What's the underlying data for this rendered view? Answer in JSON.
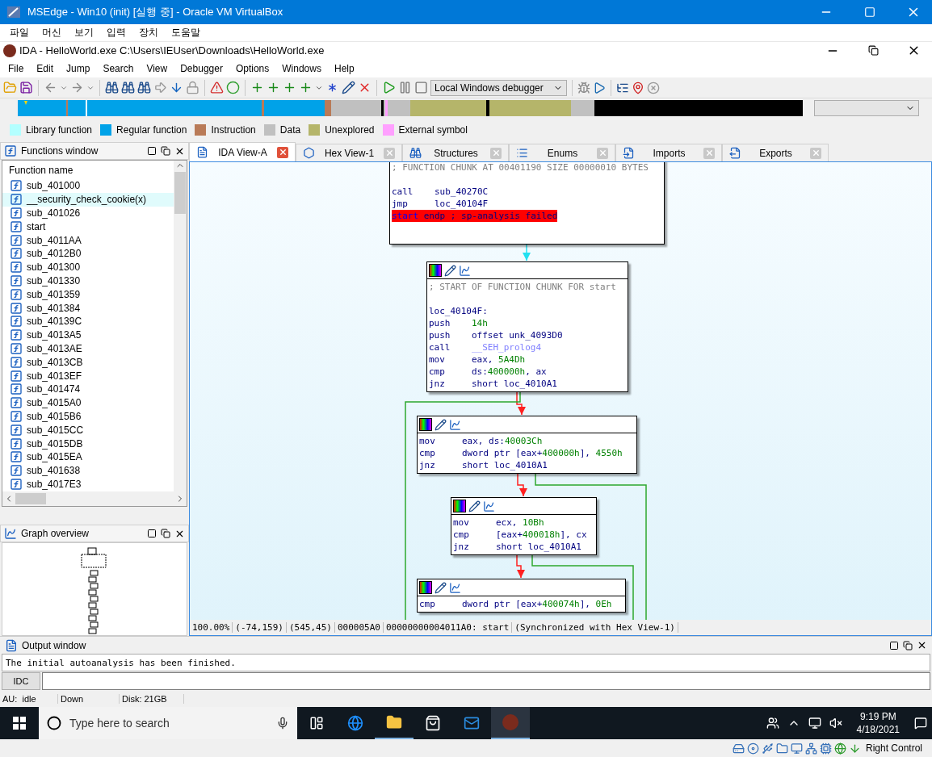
{
  "vbox_window": {
    "title": "MSEdge - Win10 (init) [실행 중] - Oracle VM VirtualBox",
    "menu": [
      "파일",
      "머신",
      "보기",
      "입력",
      "장치",
      "도움말"
    ]
  },
  "ida_window": {
    "title": "IDA - HelloWorld.exe C:\\Users\\IEUser\\Downloads\\HelloWorld.exe",
    "menu": [
      "File",
      "Edit",
      "Jump",
      "Search",
      "View",
      "Debugger",
      "Options",
      "Windows",
      "Help"
    ]
  },
  "toolbar": {
    "debugger_select": "Local Windows debugger"
  },
  "legend": [
    {
      "label": "Library function",
      "color": "#b3ffff"
    },
    {
      "label": "Regular function",
      "color": "#00a2e8"
    },
    {
      "label": "Instruction",
      "color": "#b97a57"
    },
    {
      "label": "Data",
      "color": "#c0c0c0"
    },
    {
      "label": "Unexplored",
      "color": "#b5b56a"
    },
    {
      "label": "External symbol",
      "color": "#ffa0ff"
    }
  ],
  "functions_window": {
    "title": "Functions window",
    "column": "Function name",
    "functions": [
      {
        "name": "sub_401000",
        "library": false
      },
      {
        "name": "__security_check_cookie(x)",
        "library": true
      },
      {
        "name": "sub_401026",
        "library": false
      },
      {
        "name": "start",
        "library": false
      },
      {
        "name": "sub_4011AA",
        "library": false
      },
      {
        "name": "sub_4012B0",
        "library": false
      },
      {
        "name": "sub_401300",
        "library": false
      },
      {
        "name": "sub_401330",
        "library": false
      },
      {
        "name": "sub_401359",
        "library": false
      },
      {
        "name": "sub_401384",
        "library": false
      },
      {
        "name": "sub_40139C",
        "library": false
      },
      {
        "name": "sub_4013A5",
        "library": false
      },
      {
        "name": "sub_4013AE",
        "library": false
      },
      {
        "name": "sub_4013CB",
        "library": false
      },
      {
        "name": "sub_4013EF",
        "library": false
      },
      {
        "name": "sub_401474",
        "library": false
      },
      {
        "name": "sub_4015A0",
        "library": false
      },
      {
        "name": "sub_4015B6",
        "library": false
      },
      {
        "name": "sub_4015CC",
        "library": false
      },
      {
        "name": "sub_4015DB",
        "library": false
      },
      {
        "name": "sub_4015EA",
        "library": false
      },
      {
        "name": "sub_401638",
        "library": false
      },
      {
        "name": "sub_4017E3",
        "library": false
      }
    ]
  },
  "graph_overview": {
    "title": "Graph overview"
  },
  "tabs": [
    {
      "label": "IDA View-A",
      "selected": true
    },
    {
      "label": "Hex View-1",
      "selected": false
    },
    {
      "label": "Structures",
      "selected": false
    },
    {
      "label": "Enums",
      "selected": false
    },
    {
      "label": "Imports",
      "selected": false
    },
    {
      "label": "Exports",
      "selected": false
    }
  ],
  "graph": {
    "nodes": [
      {
        "header": false,
        "lines": [
          {
            "kind": "comment",
            "text": "; FUNCTION CHUNK AT 00401190 SIZE 00000010 BYTES"
          },
          {
            "kind": "blank"
          },
          {
            "kind": "insn",
            "mnemonic": "call",
            "operands": [
              {
                "text": "sub_40270C",
                "kind": "name"
              }
            ]
          },
          {
            "kind": "insn",
            "mnemonic": "jmp",
            "operands": [
              {
                "text": "loc_40104F",
                "kind": "name"
              }
            ]
          },
          {
            "kind": "error",
            "keyword": "start",
            "text": "endp ; sp-analysis failed"
          },
          {
            "kind": "blank"
          }
        ]
      },
      {
        "header": true,
        "lines": [
          {
            "kind": "comment",
            "text": "; START OF FUNCTION CHUNK FOR start"
          },
          {
            "kind": "blank"
          },
          {
            "kind": "label",
            "text": "loc_40104F:"
          },
          {
            "kind": "insn",
            "mnemonic": "push",
            "operands": [
              {
                "text": "14h",
                "kind": "num"
              }
            ]
          },
          {
            "kind": "insn",
            "mnemonic": "push",
            "operands": [
              {
                "text": "offset unk_4093D0",
                "kind": "name"
              }
            ]
          },
          {
            "kind": "insn",
            "mnemonic": "call",
            "operands": [
              {
                "text": "__SEH_prolog4",
                "kind": "import"
              }
            ]
          },
          {
            "kind": "insn",
            "mnemonic": "mov",
            "operands": [
              {
                "text": "eax, ",
                "kind": "name"
              },
              {
                "text": "5A4Dh",
                "kind": "num"
              }
            ]
          },
          {
            "kind": "insn",
            "mnemonic": "cmp",
            "operands": [
              {
                "text": "ds:",
                "kind": "name"
              },
              {
                "text": "400000h",
                "kind": "num"
              },
              {
                "text": ", ax",
                "kind": "name"
              }
            ]
          },
          {
            "kind": "insn",
            "mnemonic": "jnz",
            "operands": [
              {
                "text": "short loc_4010A1",
                "kind": "name"
              }
            ]
          }
        ]
      },
      {
        "header": true,
        "lines": [
          {
            "kind": "insn",
            "mnemonic": "mov",
            "operands": [
              {
                "text": "eax, ds:",
                "kind": "name"
              },
              {
                "text": "40003Ch",
                "kind": "num"
              }
            ]
          },
          {
            "kind": "insn",
            "mnemonic": "cmp",
            "operands": [
              {
                "text": "dword ptr [eax+",
                "kind": "name"
              },
              {
                "text": "400000h",
                "kind": "num"
              },
              {
                "text": "], ",
                "kind": "name"
              },
              {
                "text": "4550h",
                "kind": "num"
              }
            ]
          },
          {
            "kind": "insn",
            "mnemonic": "jnz",
            "operands": [
              {
                "text": "short loc_4010A1",
                "kind": "name"
              }
            ]
          }
        ]
      },
      {
        "header": true,
        "lines": [
          {
            "kind": "insn",
            "mnemonic": "mov",
            "operands": [
              {
                "text": "ecx, ",
                "kind": "name"
              },
              {
                "text": "10Bh",
                "kind": "num"
              }
            ]
          },
          {
            "kind": "insn",
            "mnemonic": "cmp",
            "operands": [
              {
                "text": "[eax+",
                "kind": "name"
              },
              {
                "text": "400018h",
                "kind": "num"
              },
              {
                "text": "], cx",
                "kind": "name"
              }
            ]
          },
          {
            "kind": "insn",
            "mnemonic": "jnz",
            "operands": [
              {
                "text": "short loc_4010A1",
                "kind": "name"
              }
            ]
          }
        ]
      },
      {
        "header": true,
        "lines": [
          {
            "kind": "insn",
            "mnemonic": "cmp",
            "operands": [
              {
                "text": "dword ptr [eax+",
                "kind": "name"
              },
              {
                "text": "400074h",
                "kind": "num"
              },
              {
                "text": "], ",
                "kind": "name"
              },
              {
                "text": "0Eh",
                "kind": "num"
              }
            ]
          }
        ]
      }
    ],
    "edges": [
      {
        "kind": "next"
      },
      {
        "kind": "not_taken"
      },
      {
        "kind": "taken"
      },
      {
        "kind": "not_taken"
      },
      {
        "kind": "taken"
      },
      {
        "kind": "not_taken"
      },
      {
        "kind": "taken"
      }
    ],
    "status": [
      "100.00%",
      "(-74,159)",
      "(545,45)",
      "000005A0",
      "00000000004011A0: start",
      "(Synchronized with Hex View-1)"
    ]
  },
  "output_window": {
    "title": "Output window",
    "text": "The initial autoanalysis has been finished.",
    "idc_button": "IDC"
  },
  "status_bar": [
    "AU:  idle",
    "Down",
    "Disk: 21GB"
  ],
  "taskbar": {
    "search_placeholder": "Type here to search",
    "time": "9:19 PM",
    "date": "4/18/2021"
  },
  "vbox_status": {
    "host_key": "Right Control"
  }
}
